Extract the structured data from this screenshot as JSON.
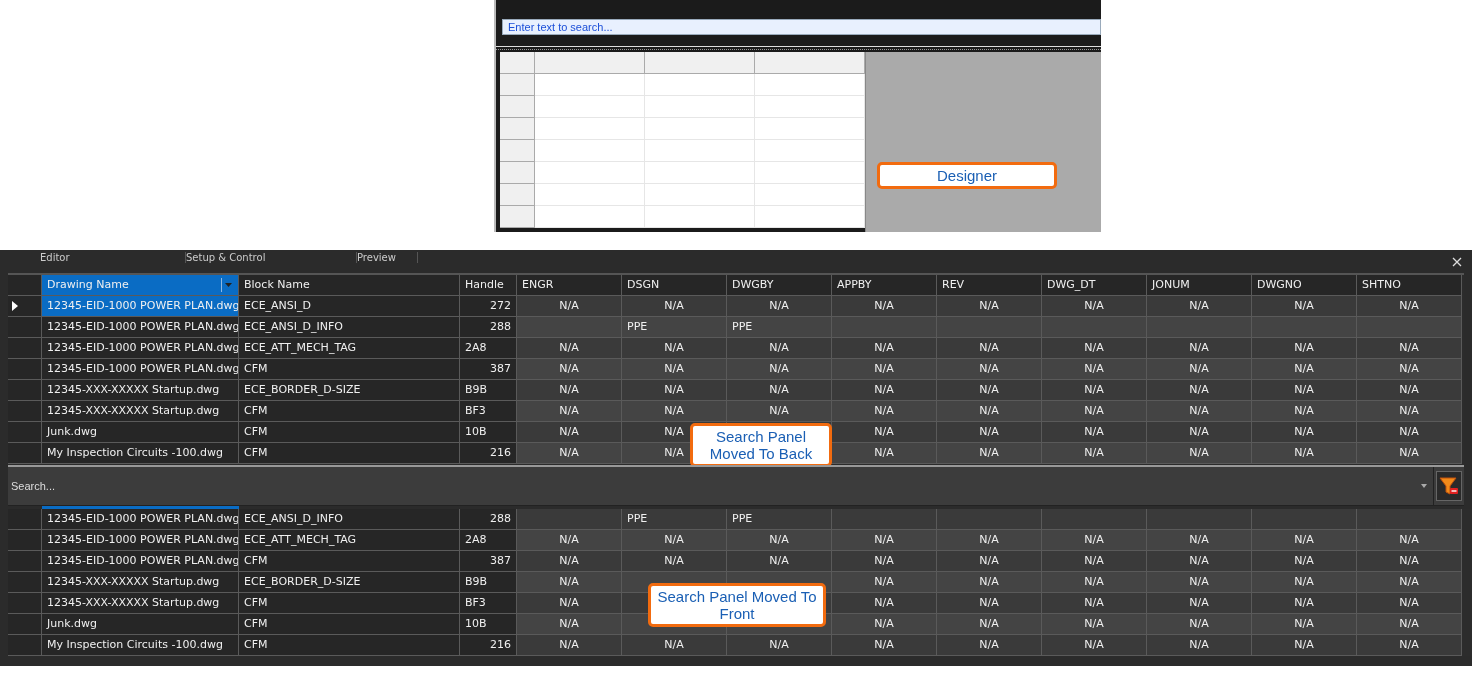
{
  "designer": {
    "search": {
      "placeholder": "Enter text to search..."
    },
    "callout": "Designer"
  },
  "tabs": [
    {
      "label": "Editor"
    },
    {
      "label": "Setup & Control"
    },
    {
      "label": "Preview"
    }
  ],
  "grid_back": {
    "columns": [
      {
        "label": "Drawing Name",
        "selected": true
      },
      {
        "label": "Block Name",
        "selected": false
      },
      {
        "label": "Handle",
        "selected": false
      },
      {
        "label": "ENGR",
        "selected": false
      },
      {
        "label": "DSGN",
        "selected": false
      },
      {
        "label": "DWGBY",
        "selected": false
      },
      {
        "label": "APPBY",
        "selected": false
      },
      {
        "label": "REV",
        "selected": false
      },
      {
        "label": "DWG_DT",
        "selected": false
      },
      {
        "label": "JONUM",
        "selected": false
      },
      {
        "label": "DWGNO",
        "selected": false
      },
      {
        "label": "SHTNO",
        "selected": false
      }
    ],
    "rows": [
      {
        "selected": true,
        "cells": [
          "12345-EID-1000 POWER PLAN.dwg",
          "ECE_ANSI_D",
          "272",
          "N/A",
          "N/A",
          "N/A",
          "N/A",
          "N/A",
          "N/A",
          "N/A",
          "N/A",
          "N/A"
        ]
      },
      {
        "selected": false,
        "cells": [
          "12345-EID-1000 POWER PLAN.dwg",
          "ECE_ANSI_D_INFO",
          "288",
          null,
          "PPE",
          "PPE",
          null,
          null,
          null,
          null,
          null,
          null
        ]
      },
      {
        "selected": false,
        "cells": [
          "12345-EID-1000 POWER PLAN.dwg",
          "ECE_ATT_MECH_TAG",
          "2A8",
          "N/A",
          "N/A",
          "N/A",
          "N/A",
          "N/A",
          "N/A",
          "N/A",
          "N/A",
          "N/A"
        ]
      },
      {
        "selected": false,
        "cells": [
          "12345-EID-1000 POWER PLAN.dwg",
          "CFM",
          "387",
          "N/A",
          "N/A",
          "N/A",
          "N/A",
          "N/A",
          "N/A",
          "N/A",
          "N/A",
          "N/A"
        ]
      },
      {
        "selected": false,
        "cells": [
          "12345-XXX-XXXXX Startup.dwg",
          "ECE_BORDER_D-SIZE",
          "B9B",
          "N/A",
          "N/A",
          "N/A",
          "N/A",
          "N/A",
          "N/A",
          "N/A",
          "N/A",
          "N/A"
        ]
      },
      {
        "selected": false,
        "cells": [
          "12345-XXX-XXXXX Startup.dwg",
          "CFM",
          "BF3",
          "N/A",
          "N/A",
          "N/A",
          "N/A",
          "N/A",
          "N/A",
          "N/A",
          "N/A",
          "N/A"
        ]
      },
      {
        "selected": false,
        "cells": [
          "Junk.dwg",
          "CFM",
          "10B",
          "N/A",
          "N/A",
          null,
          "N/A",
          "N/A",
          "N/A",
          "N/A",
          "N/A",
          "N/A"
        ]
      },
      {
        "selected": false,
        "cells": [
          "My Inspection Circuits -100.dwg",
          "CFM",
          "216",
          "N/A",
          "N/A",
          null,
          "N/A",
          "N/A",
          "N/A",
          "N/A",
          "N/A",
          "N/A"
        ]
      }
    ],
    "callout": "Search Panel Moved To Back"
  },
  "grid_front": {
    "search": {
      "placeholder": "Search..."
    },
    "rows": [
      {
        "selected": false,
        "cells": [
          "12345-EID-1000 POWER PLAN.dwg",
          "ECE_ANSI_D_INFO",
          "288",
          null,
          "PPE",
          "PPE",
          null,
          null,
          null,
          null,
          null,
          null
        ]
      },
      {
        "selected": false,
        "cells": [
          "12345-EID-1000 POWER PLAN.dwg",
          "ECE_ATT_MECH_TAG",
          "2A8",
          "N/A",
          "N/A",
          "N/A",
          "N/A",
          "N/A",
          "N/A",
          "N/A",
          "N/A",
          "N/A"
        ]
      },
      {
        "selected": false,
        "cells": [
          "12345-EID-1000 POWER PLAN.dwg",
          "CFM",
          "387",
          "N/A",
          "N/A",
          "N/A",
          "N/A",
          "N/A",
          "N/A",
          "N/A",
          "N/A",
          "N/A"
        ]
      },
      {
        "selected": false,
        "cells": [
          "12345-XXX-XXXXX Startup.dwg",
          "ECE_BORDER_D-SIZE",
          "B9B",
          "N/A",
          null,
          null,
          "N/A",
          "N/A",
          "N/A",
          "N/A",
          "N/A",
          "N/A"
        ]
      },
      {
        "selected": false,
        "cells": [
          "12345-XXX-XXXXX Startup.dwg",
          "CFM",
          "BF3",
          "N/A",
          null,
          null,
          "N/A",
          "N/A",
          "N/A",
          "N/A",
          "N/A",
          "N/A"
        ]
      },
      {
        "selected": false,
        "cells": [
          "Junk.dwg",
          "CFM",
          "10B",
          "N/A",
          null,
          null,
          "N/A",
          "N/A",
          "N/A",
          "N/A",
          "N/A",
          "N/A"
        ]
      },
      {
        "selected": false,
        "cells": [
          "My Inspection Circuits -100.dwg",
          "CFM",
          "216",
          "N/A",
          "N/A",
          "N/A",
          "N/A",
          "N/A",
          "N/A",
          "N/A",
          "N/A",
          "N/A"
        ]
      }
    ],
    "callout": "Search Panel Moved To Front"
  }
}
